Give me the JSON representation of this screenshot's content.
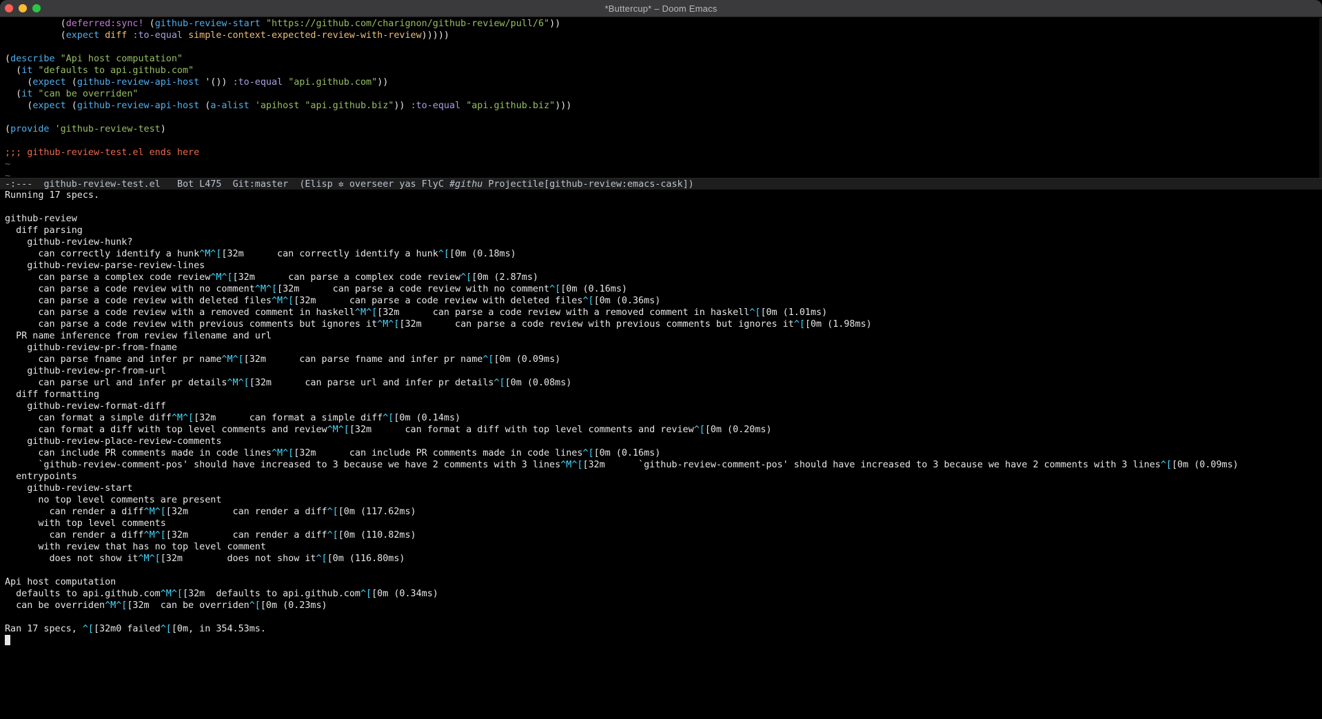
{
  "window": {
    "title": "*Buttercup* – Doom Emacs"
  },
  "editor": {
    "lines": [
      [
        [
          "",
          "          "
        ],
        [
          "paren",
          "("
        ],
        [
          "fn",
          "deferred:sync!"
        ],
        [
          "",
          " ("
        ],
        [
          "kw",
          "github-review-start"
        ],
        [
          "",
          " "
        ],
        [
          "str",
          "\"https://github.com/charignon/github-review/pull/6\""
        ],
        [
          "",
          "))"
        ]
      ],
      [
        [
          "",
          "          ("
        ],
        [
          "kw",
          "expect"
        ],
        [
          "",
          " "
        ],
        [
          "fnd",
          "diff"
        ],
        [
          "",
          " "
        ],
        [
          "sym",
          ":to-equal"
        ],
        [
          "",
          " "
        ],
        [
          "fnd",
          "simple-context-expected-review-with-review"
        ],
        [
          "",
          ")))))"
        ]
      ],
      [
        [
          "",
          ""
        ]
      ],
      [
        [
          "",
          "("
        ],
        [
          "kw",
          "describe"
        ],
        [
          "",
          " "
        ],
        [
          "str",
          "\"Api host computation\""
        ]
      ],
      [
        [
          "",
          "  ("
        ],
        [
          "kw",
          "it"
        ],
        [
          "",
          " "
        ],
        [
          "str",
          "\"defaults to api.github.com\""
        ]
      ],
      [
        [
          "",
          "    ("
        ],
        [
          "kw",
          "expect"
        ],
        [
          "",
          " ("
        ],
        [
          "kw",
          "github-review-api-host"
        ],
        [
          "",
          " '()) "
        ],
        [
          "sym",
          ":to-equal"
        ],
        [
          "",
          " "
        ],
        [
          "str",
          "\"api.github.com\""
        ],
        [
          "",
          "))"
        ]
      ],
      [
        [
          "",
          "  ("
        ],
        [
          "kw",
          "it"
        ],
        [
          "",
          " "
        ],
        [
          "str",
          "\"can be overriden\""
        ]
      ],
      [
        [
          "",
          "    ("
        ],
        [
          "kw",
          "expect"
        ],
        [
          "",
          " ("
        ],
        [
          "kw",
          "github-review-api-host"
        ],
        [
          "",
          " ("
        ],
        [
          "kw",
          "a-alist"
        ],
        [
          "",
          " "
        ],
        [
          "str",
          "'apihost"
        ],
        [
          "",
          " "
        ],
        [
          "str",
          "\"api.github.biz\""
        ],
        [
          "",
          ")) "
        ],
        [
          "sym",
          ":to-equal"
        ],
        [
          "",
          " "
        ],
        [
          "str",
          "\"api.github.biz\""
        ],
        [
          "",
          ")))"
        ]
      ],
      [
        [
          "",
          ""
        ]
      ],
      [
        [
          "",
          "("
        ],
        [
          "kw",
          "provide"
        ],
        [
          "",
          " "
        ],
        [
          "str",
          "'github-review-test"
        ],
        [
          "",
          ")"
        ]
      ],
      [
        [
          "",
          ""
        ]
      ],
      [
        [
          "cmt",
          ";;; github-review-test.el ends here"
        ]
      ],
      [
        [
          "tilde",
          "~"
        ]
      ],
      [
        [
          "tilde",
          "~"
        ]
      ]
    ]
  },
  "modeline": {
    "state": "-:---",
    "buffer": "github-review-test.el",
    "position": "Bot L475",
    "vcs": "Git:master",
    "modes_pre": "(Elisp ✲ overseer yas FlyC ",
    "modes_italic": "#githu",
    "modes_post": " Projectile[github-review:emacs-cask])"
  },
  "output": {
    "lines": [
      "Running 17 specs.",
      "",
      "github-review",
      "  diff parsing",
      "    github-review-hunk?",
      "      can correctly identify a hunk^M^[[32m      can correctly identify a hunk^[[0m (0.18ms)",
      "    github-review-parse-review-lines",
      "      can parse a complex code review^M^[[32m      can parse a complex code review^[[0m (2.87ms)",
      "      can parse a code review with no comment^M^[[32m      can parse a code review with no comment^[[0m (0.16ms)",
      "      can parse a code review with deleted files^M^[[32m      can parse a code review with deleted files^[[0m (0.36ms)",
      "      can parse a code review with a removed comment in haskell^M^[[32m      can parse a code review with a removed comment in haskell^[[0m (1.01ms)",
      "      can parse a code review with previous comments but ignores it^M^[[32m      can parse a code review with previous comments but ignores it^[[0m (1.98ms)",
      "  PR name inference from review filename and url",
      "    github-review-pr-from-fname",
      "      can parse fname and infer pr name^M^[[32m      can parse fname and infer pr name^[[0m (0.09ms)",
      "    github-review-pr-from-url",
      "      can parse url and infer pr details^M^[[32m      can parse url and infer pr details^[[0m (0.08ms)",
      "  diff formatting",
      "    github-review-format-diff",
      "      can format a simple diff^M^[[32m      can format a simple diff^[[0m (0.14ms)",
      "      can format a diff with top level comments and review^M^[[32m      can format a diff with top level comments and review^[[0m (0.20ms)",
      "    github-review-place-review-comments",
      "      can include PR comments made in code lines^M^[[32m      can include PR comments made in code lines^[[0m (0.16ms)",
      "      `github-review-comment-pos' should have increased to 3 because we have 2 comments with 3 lines^M^[[32m      `github-review-comment-pos' should have increased to 3 because we have 2 comments with 3 lines^[[0m (0.09ms)",
      "  entrypoints",
      "    github-review-start",
      "      no top level comments are present",
      "        can render a diff^M^[[32m        can render a diff^[[0m (117.62ms)",
      "      with top level comments",
      "        can render a diff^M^[[32m        can render a diff^[[0m (110.82ms)",
      "      with review that has no top level comment",
      "        does not show it^M^[[32m        does not show it^[[0m (116.80ms)",
      "",
      "Api host computation",
      "  defaults to api.github.com^M^[[32m  defaults to api.github.com^[[0m (0.34ms)",
      "  can be overriden^M^[[32m  can be overriden^[[0m (0.23ms)",
      "",
      "Ran 17 specs, ^[[32m0 failed^[[0m, in 354.53ms."
    ]
  },
  "colors": {
    "keyword": "#51afef",
    "string": "#98be65",
    "comment": "#e86a4c",
    "control_char": "#46d9ff",
    "text": "#e6e6e6",
    "background": "#000000"
  }
}
